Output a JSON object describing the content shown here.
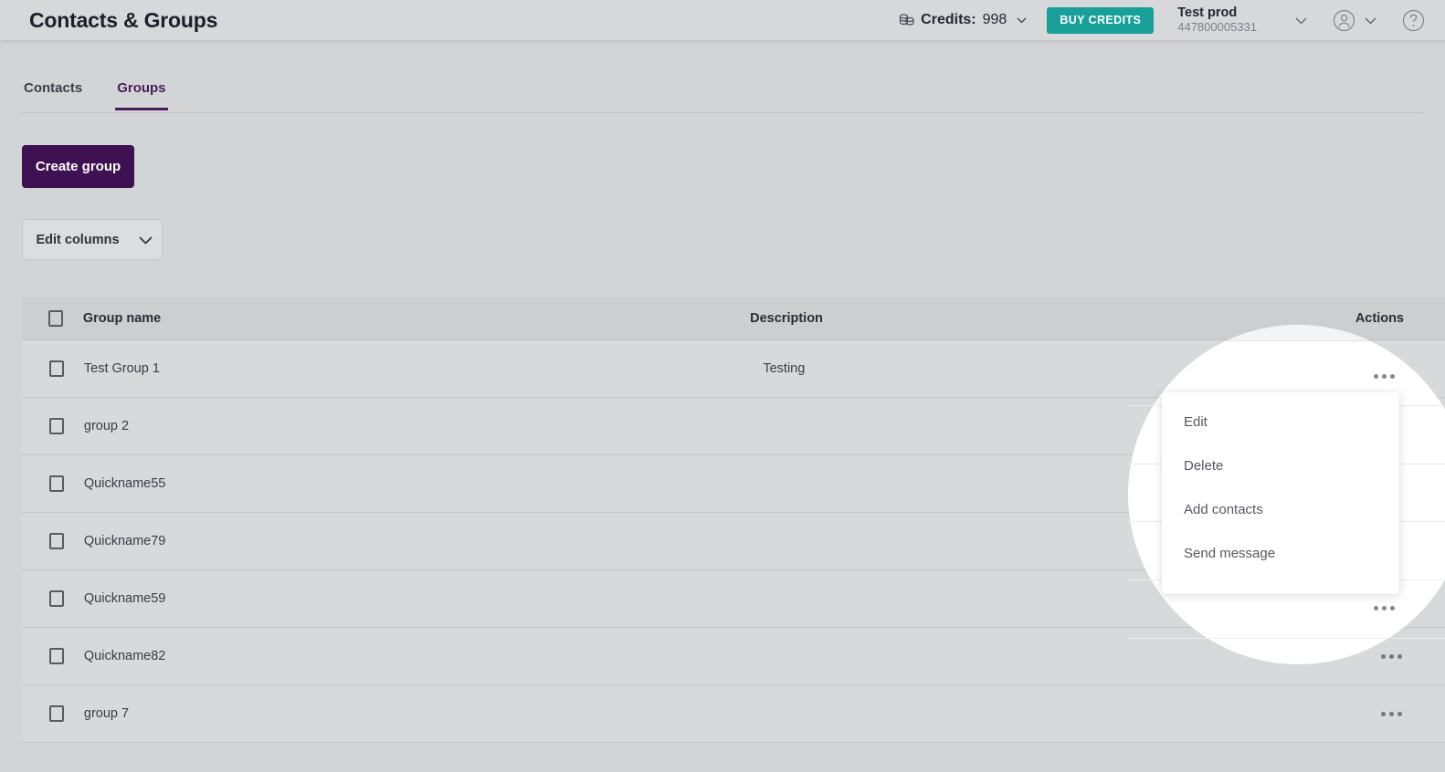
{
  "header": {
    "title": "Contacts & Groups",
    "credits_icon": "coins-icon",
    "credits_label": "Credits:",
    "credits_value": "998",
    "buy_credits_label": "BUY CREDITS",
    "account_name": "Test prod",
    "account_number": "447800005331",
    "user_icon": "user-circle-icon",
    "help_icon": "help-circle-icon",
    "chevron_icon": "chevron-down-icon"
  },
  "tabs": [
    {
      "label": "Contacts",
      "active": false
    },
    {
      "label": "Groups",
      "active": true
    }
  ],
  "toolbar": {
    "create_group_label": "Create group",
    "edit_columns_label": "Edit columns"
  },
  "table": {
    "columns": {
      "group_name": "Group name",
      "description": "Description",
      "actions": "Actions"
    },
    "rows": [
      {
        "name": "Test Group 1",
        "description": "Testing"
      },
      {
        "name": "group 2",
        "description": ""
      },
      {
        "name": "Quickname55",
        "description": ""
      },
      {
        "name": "Quickname79",
        "description": ""
      },
      {
        "name": "Quickname59",
        "description": ""
      },
      {
        "name": "Quickname82",
        "description": ""
      },
      {
        "name": "group 7",
        "description": ""
      }
    ]
  },
  "action_menu": {
    "items": [
      {
        "label": "Edit"
      },
      {
        "label": "Delete"
      },
      {
        "label": "Add contacts"
      },
      {
        "label": "Send message"
      }
    ]
  },
  "colors": {
    "brand_purple": "#3d1152",
    "accent_teal": "#18a098",
    "page_bg": "#d3d4d6",
    "row_bg": "#d8d9db",
    "header_row_bg": "#cdced0"
  }
}
